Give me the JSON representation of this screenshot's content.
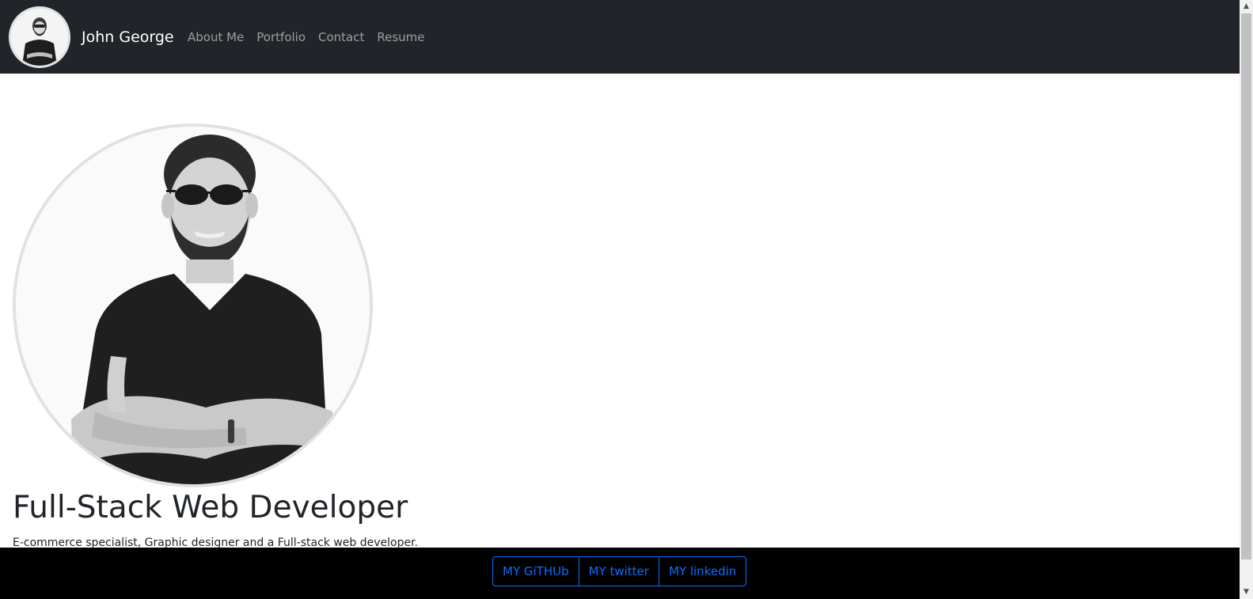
{
  "navbar": {
    "brand": "John George",
    "links": [
      "About Me",
      "Portfolio",
      "Contact",
      "Resume"
    ]
  },
  "hero": {
    "title": "Full-Stack Web Developer",
    "subtitle": "E-commerce specialist, Graphic designer and a Full-stack web developer."
  },
  "footer": {
    "buttons": [
      "MY GiTHUb",
      "MY twitter",
      "MY linkedin"
    ]
  },
  "colors": {
    "navbar_bg": "#212529",
    "footer_bg": "#000000",
    "link_blue": "#0d6efd"
  },
  "icons": {
    "scroll_up": "scroll-up-arrow-icon",
    "scroll_down": "scroll-down-arrow-icon"
  }
}
